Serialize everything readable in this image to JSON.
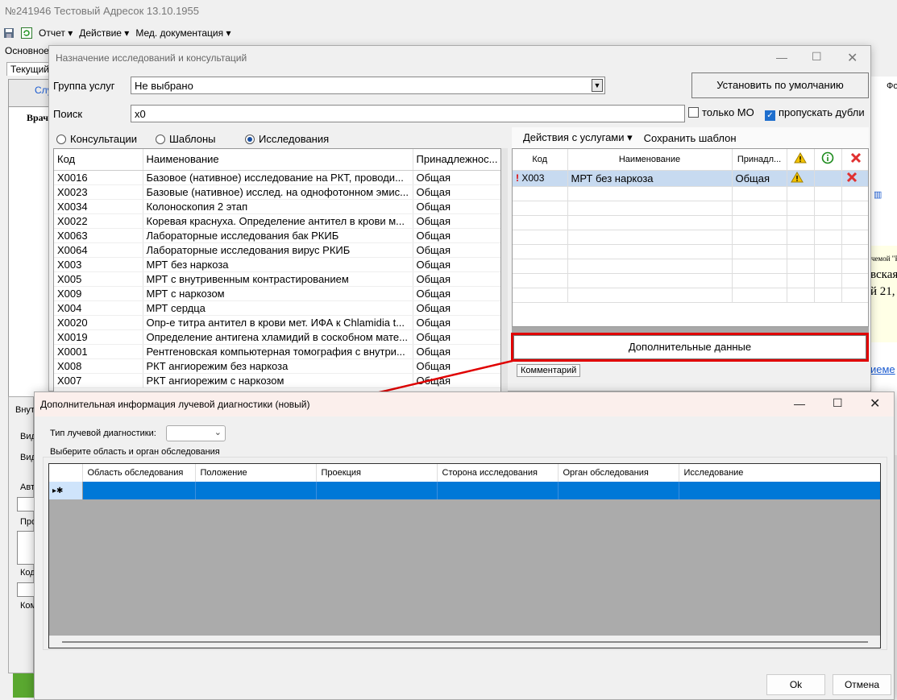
{
  "main": {
    "title": "№241946 Тестовый Адресок  13.10.1955",
    "menu": {
      "report": "Отчет ▾",
      "action": "Действие ▾",
      "meddoc": "Мед. документация ▾"
    },
    "tabs": {
      "main": "Основное",
      "current": "Текущий сл"
    },
    "left_frag": {
      "services": "Слу",
      "doctor": "Врач"
    },
    "bottom_frag": {
      "inner": "Внутр",
      "vid1": "Вид",
      "vid2": "Вид",
      "auto": "Авт",
      "pro": "Про",
      "kod": "Код",
      "kom": "Ком"
    },
    "right_frag": {
      "fo": "Фо",
      "r1": "чемой \"Р",
      "r2": "вская",
      "r3": "й 21,",
      "r4": "иеме"
    }
  },
  "dlg1": {
    "title": "Назначение исследований и консультаций",
    "group_label": "Группа услуг",
    "group_value": "Не выбрано",
    "set_default": "Установить по умолчанию",
    "search_label": "Поиск",
    "search_value": "x0",
    "only_mo": "только МО",
    "skip_dupes": "пропускать дубли",
    "radio": {
      "consult": "Консультации",
      "templates": "Шаблоны",
      "research": "Исследования"
    },
    "table": {
      "headers": [
        "Код",
        "Наименование",
        "Принадлежнос..."
      ],
      "rows": [
        [
          "X0016",
          "Базовое (нативное) исследование на РКТ, проводи...",
          "Общая"
        ],
        [
          "X0023",
          "Базовые (нативное) исслед. на однофотонном эмис...",
          "Общая"
        ],
        [
          "X0034",
          "Колоноскопия 2 этап",
          "Общая"
        ],
        [
          "X0022",
          "Коревая краснуха. Определение антител в крови м...",
          "Общая"
        ],
        [
          "X0063",
          "Лабораторные исследования бак РКИБ",
          "Общая"
        ],
        [
          "X0064",
          "Лабораторные исследования вирус РКИБ",
          "Общая"
        ],
        [
          "X003",
          "МРТ без наркоза",
          "Общая"
        ],
        [
          "X005",
          "МРТ с внутривенным  контрастированием",
          "Общая"
        ],
        [
          "X009",
          "МРТ с наркозом",
          "Общая"
        ],
        [
          "X004",
          "МРТ сердца",
          "Общая"
        ],
        [
          "X0020",
          "Опр-е титра антител в крови мет. ИФА к Chlamidia t...",
          "Общая"
        ],
        [
          "X0019",
          "Определение антигена хламидий в соскобном мате...",
          "Общая"
        ],
        [
          "X0001",
          "Рентгеновская компьютерная томография с внутри...",
          "Общая"
        ],
        [
          "X008",
          "РКТ ангиорежим без наркоза",
          "Общая"
        ],
        [
          "X007",
          "РКТ ангиорежим с наркозом",
          "Общая"
        ]
      ]
    },
    "actions": "Действия с услугами ▾",
    "save_template": "Сохранить шаблон",
    "sel_table": {
      "headers": [
        "Код",
        "Наименование",
        "Принадл..."
      ],
      "rows": [
        {
          "mark": "!",
          "code": "X003",
          "name": "МРТ без наркоза",
          "owner": "Общая"
        }
      ]
    },
    "extra_data": "Дополнительные данные",
    "comment_tab": "Комментарий"
  },
  "dlg2": {
    "title": "Дополнительная информация лучевой диагностики (новый)",
    "type_label": "Тип лучевой диагностики:",
    "area_label": "Выберите область и орган обследования",
    "headers": [
      "Область обследования",
      "Положение",
      "Проекция",
      "Сторона исследования",
      "Орган обследования",
      "Исследование"
    ],
    "row_marker": "▸✱",
    "ok": "Ok",
    "cancel": "Отмена"
  },
  "colors": {
    "accent": "#0078d7",
    "highlight_box": "#e00000",
    "selection": "#c7daf0"
  }
}
